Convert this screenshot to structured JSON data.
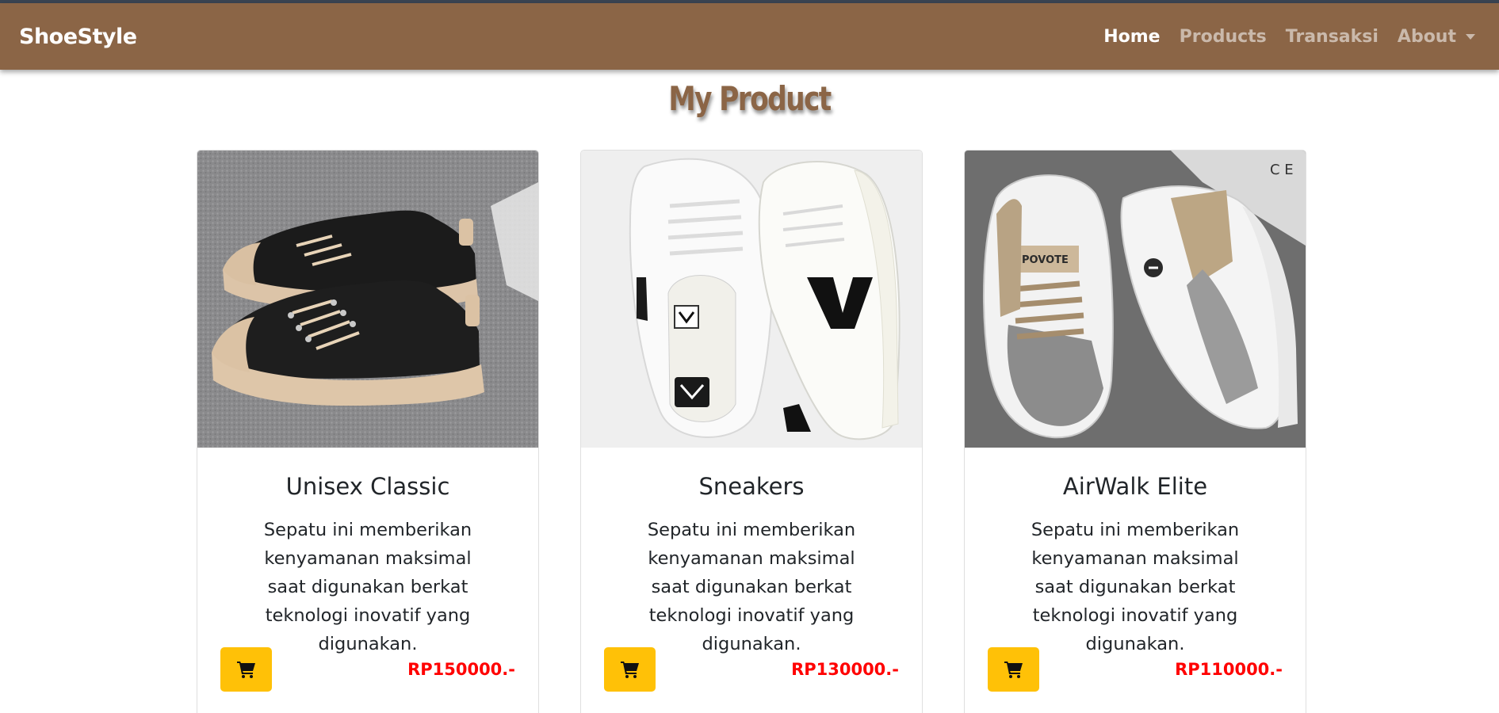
{
  "navbar": {
    "brand": "ShoeStyle",
    "links": [
      {
        "label": "Home",
        "active": true
      },
      {
        "label": "Products",
        "active": false
      },
      {
        "label": "Transaksi",
        "active": false
      },
      {
        "label": "About",
        "active": false,
        "dropdown": true
      }
    ],
    "background": "#8b6546"
  },
  "page": {
    "title": "My Product",
    "title_color": "#8b6546"
  },
  "products": [
    {
      "name": "Unisex Classic",
      "description": "Sepatu ini memberikan kenyamanan maksimal saat digunakan berkat teknologi inovatif yang digunakan.",
      "price": "RP150000.-",
      "image": "black canvas sneakers with beige sole on grey carpet"
    },
    {
      "name": "Sneakers",
      "description": "Sepatu ini memberikan kenyamanan maksimal saat digunakan berkat teknologi inovatif yang digunakan.",
      "price": "RP130000.-",
      "image": "white leather sneakers with black V logo"
    },
    {
      "name": "AirWalk Elite",
      "description": "Sepatu ini memberikan kenyamanan maksimal saat digunakan berkat teknologi inovatif yang digunakan.",
      "price": "RP110000.-",
      "image": "white grey and beige chunky sneakers on dark grey background"
    }
  ],
  "colors": {
    "cart_button": "#ffc107",
    "price": "#ff0000"
  },
  "icons": {
    "cart": "shopping-cart-icon",
    "dropdown": "caret-down-icon"
  }
}
